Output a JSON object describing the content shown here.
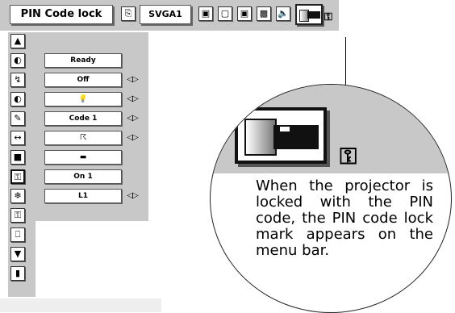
{
  "menubar": {
    "title": "PIN Code lock",
    "input_label": "SVGA1",
    "lock_glyph": "⚿"
  },
  "side_menu": {
    "values": [
      "Ready",
      "Off",
      "💡",
      "Code 1",
      "☈",
      "▬",
      "On 1",
      "L1"
    ],
    "arrows": "◁▷"
  },
  "callout": {
    "lock_glyph": "⚿",
    "text": "When the projector is locked with the PIN code, the PIN code lock mark appears on the menu bar."
  }
}
